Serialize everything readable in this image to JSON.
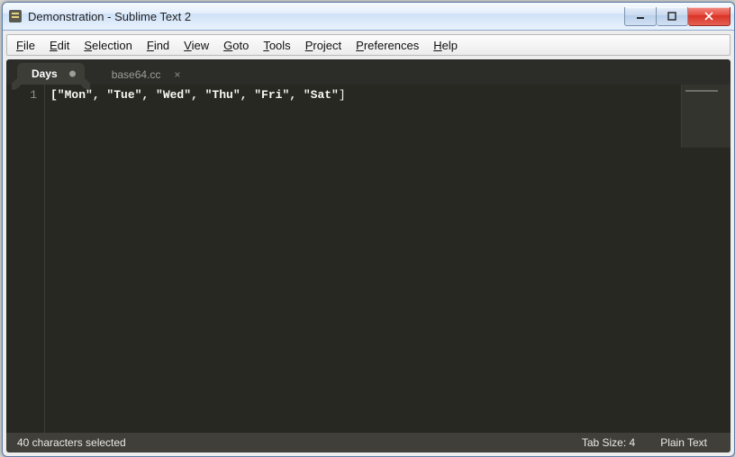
{
  "window": {
    "title": "Demonstration - Sublime Text 2"
  },
  "menubar": [
    "File",
    "Edit",
    "Selection",
    "Find",
    "View",
    "Goto",
    "Tools",
    "Project",
    "Preferences",
    "Help"
  ],
  "tabs": [
    {
      "label": "Days",
      "active": true,
      "dirty": true
    },
    {
      "label": "base64.cc",
      "active": false,
      "dirty": false
    }
  ],
  "editor": {
    "line_number": "1",
    "content": "[\"Mon\", \"Tue\", \"Wed\", \"Thu\", \"Fri\", \"Sat\"]",
    "selected_part": "[\"Mon\", \"Tue\", \"Wed\", \"Thu\", \"Fri\", \"Sat\"",
    "after_part": "]"
  },
  "statusbar": {
    "left": "40 characters selected",
    "tab_size": "Tab Size: 4",
    "syntax": "Plain Text"
  }
}
